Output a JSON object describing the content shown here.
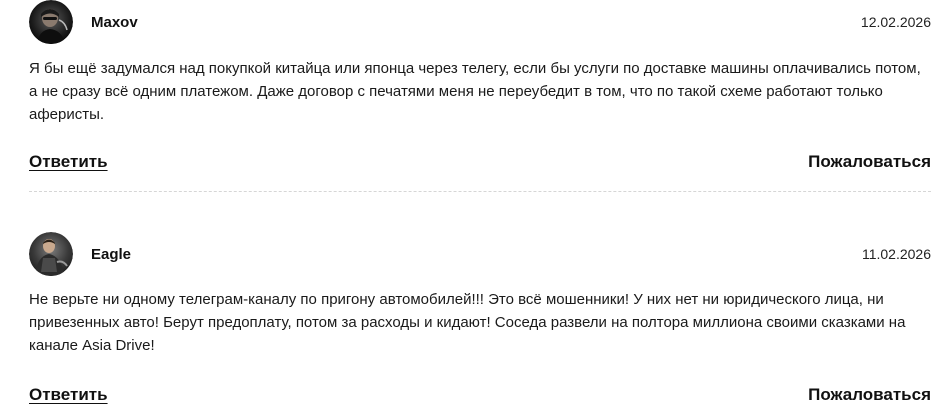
{
  "comments": [
    {
      "author": "Maxov",
      "date": "12.02.2026",
      "text": "Я бы ещё задумался над покупкой китайца или японца через телегу, если бы услуги по доставке машины оплачивались потом, а не сразу всё одним платежом. Даже договор с печатями меня не переубедит в том, что по такой схеме работают только аферисты.",
      "reply_label": "Ответить",
      "report_label": "Пожаловаться"
    },
    {
      "author": "Eagle",
      "date": "11.02.2026",
      "text": "Не верьте ни одному телеграм-каналу по пригону автомобилей!!! Это всё мошенники! У них нет ни юридического лица, ни привезенных авто! Берут предоплату, потом за расходы и кидают! Соседа развели на полтора миллиона своими сказками на канале Asia Drive!",
      "reply_label": "Ответить",
      "report_label": "Пожаловаться"
    }
  ]
}
